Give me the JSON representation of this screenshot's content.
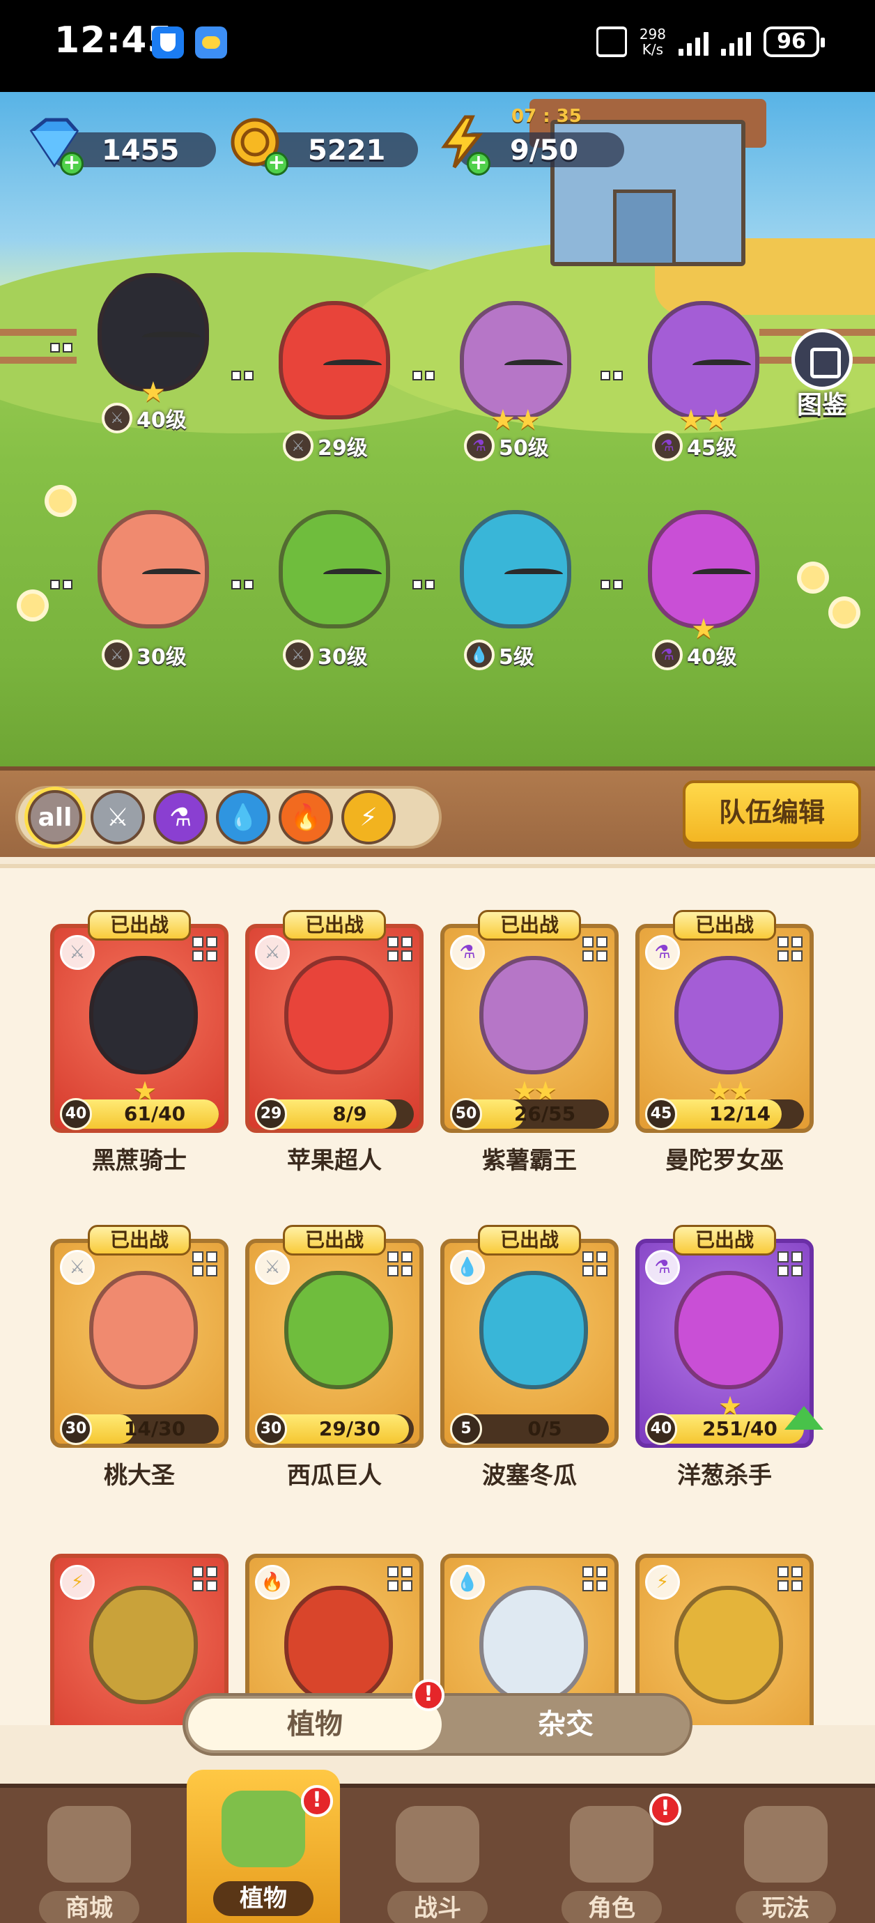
{
  "status_bar": {
    "time": "12:45",
    "net_speed_value": "298",
    "net_speed_unit": "K/s",
    "battery": "96"
  },
  "resources": {
    "gems": "1455",
    "coins": "5221",
    "energy": "9/50",
    "energy_timer": "07 : 35"
  },
  "gallery_label": "图鉴",
  "scene_plants": [
    {
      "element": "sword",
      "level": "40级",
      "color": "#2b2b33",
      "stars": "★"
    },
    {
      "element": "sword",
      "level": "29级",
      "color": "#e8443a",
      "stars": ""
    },
    {
      "element": "potion",
      "level": "50级",
      "color": "#b676c7",
      "stars": "★★"
    },
    {
      "element": "potion",
      "level": "45级",
      "color": "#a45dd6",
      "stars": "★★"
    },
    {
      "element": "sword",
      "level": "30级",
      "color": "#f08a6f",
      "stars": ""
    },
    {
      "element": "sword",
      "level": "30级",
      "color": "#6fbd3d",
      "stars": ""
    },
    {
      "element": "water",
      "level": "5级",
      "color": "#39b6d8",
      "stars": ""
    },
    {
      "element": "potion",
      "level": "40级",
      "color": "#c94fd6",
      "stars": "★"
    }
  ],
  "filters": [
    "all",
    "sword",
    "potion",
    "water",
    "fire",
    "lightning"
  ],
  "filter_all_label": "all",
  "team_edit_label": "队伍编辑",
  "fought_label": "已出战",
  "cards": [
    {
      "name": "黑蔗骑士",
      "level": "40",
      "count": "61/40",
      "progress": 1.0,
      "stars": "★",
      "element": "sword",
      "bg": "red",
      "color": "#2b2b33",
      "upgrade": false
    },
    {
      "name": "苹果超人",
      "level": "29",
      "count": "8/9",
      "progress": 0.89,
      "stars": "",
      "element": "sword",
      "bg": "red",
      "color": "#e8443a",
      "upgrade": false
    },
    {
      "name": "紫薯霸王",
      "level": "50",
      "count": "26/55",
      "progress": 0.47,
      "stars": "★★",
      "element": "potion",
      "bg": "gold",
      "color": "#b676c7",
      "upgrade": false
    },
    {
      "name": "曼陀罗女巫",
      "level": "45",
      "count": "12/14",
      "progress": 0.86,
      "stars": "★★",
      "element": "potion",
      "bg": "gold",
      "color": "#a45dd6",
      "upgrade": false
    },
    {
      "name": "桃大圣",
      "level": "30",
      "count": "14/30",
      "progress": 0.47,
      "stars": "",
      "element": "sword",
      "bg": "gold",
      "color": "#f08a6f",
      "upgrade": false
    },
    {
      "name": "西瓜巨人",
      "level": "30",
      "count": "29/30",
      "progress": 0.97,
      "stars": "",
      "element": "sword",
      "bg": "gold",
      "color": "#6fbd3d",
      "upgrade": false
    },
    {
      "name": "波塞冬瓜",
      "level": "5",
      "count": "0/5",
      "progress": 0.0,
      "stars": "",
      "element": "water",
      "bg": "gold",
      "color": "#39b6d8",
      "upgrade": false
    },
    {
      "name": "洋葱杀手",
      "level": "40",
      "count": "251/40",
      "progress": 1.0,
      "stars": "★",
      "element": "potion",
      "bg": "purple",
      "color": "#c94fd6",
      "upgrade": true
    }
  ],
  "partial_cards": [
    {
      "element": "lightning",
      "bg": "red",
      "color": "#c9a23a"
    },
    {
      "element": "fire",
      "bg": "gold",
      "color": "#d9452b"
    },
    {
      "element": "water",
      "bg": "gold",
      "color": "#dfe9f2"
    },
    {
      "element": "lightning",
      "bg": "gold",
      "color": "#e4b43a"
    }
  ],
  "segment": {
    "active": "植物",
    "inactive": "杂交",
    "alert": "!"
  },
  "nav": [
    {
      "label": "商城",
      "icon": "shop-icon",
      "active": false,
      "alert": false
    },
    {
      "label": "植物",
      "icon": "plants-icon",
      "active": true,
      "alert": true
    },
    {
      "label": "战斗",
      "icon": "battle-icon",
      "active": false,
      "alert": false
    },
    {
      "label": "角色",
      "icon": "character-icon",
      "active": false,
      "alert": true
    },
    {
      "label": "玩法",
      "icon": "gameplay-icon",
      "active": false,
      "alert": false
    }
  ],
  "colors": {
    "sword": "#9aa0a8",
    "potion": "#8a3fd1",
    "water": "#2f95e0",
    "fire": "#f26a1f",
    "lightning": "#f2b31f"
  }
}
